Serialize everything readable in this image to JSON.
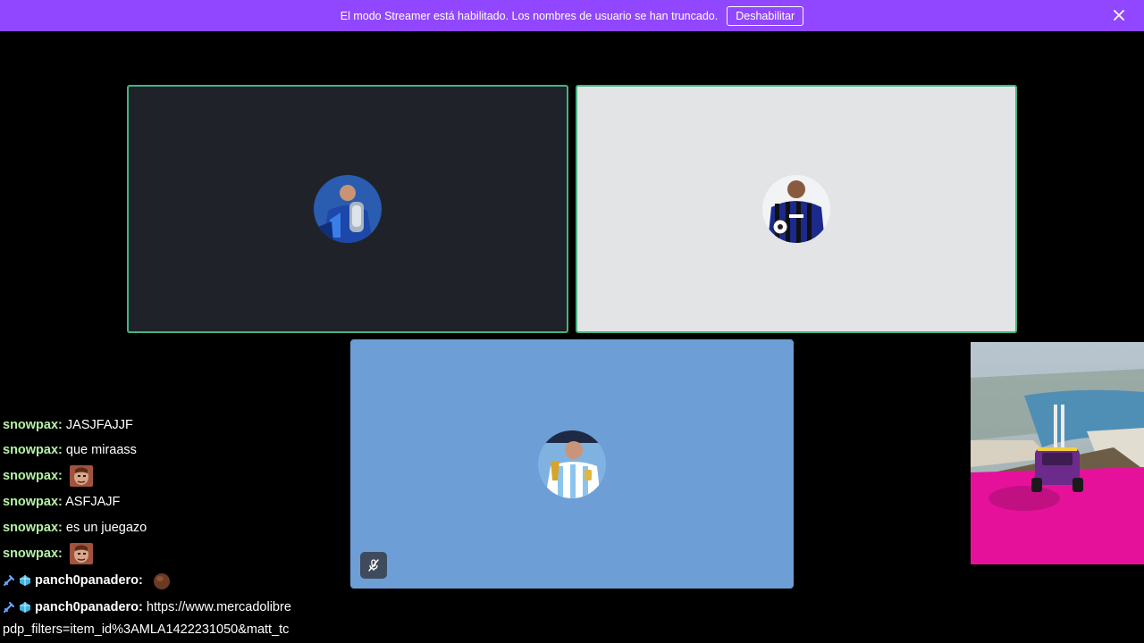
{
  "banner": {
    "message": "El modo Streamer está habilitado. Los nombres de usuario se han truncado.",
    "button_label": "Deshabilitar",
    "close_icon": "close-icon",
    "color": "#9147ff"
  },
  "tiles": [
    {
      "name": "participant-1",
      "background": "#1f2229",
      "speaking": true,
      "avatar": "avatar-blue-jersey-trophy"
    },
    {
      "name": "participant-2",
      "background": "#e3e4e6",
      "speaking": true,
      "avatar": "avatar-striped-jersey-ball"
    },
    {
      "name": "participant-3",
      "background": "#6d9fd6",
      "speaking": false,
      "muted": true,
      "avatar": "avatar-argentina-trophy",
      "mute_icon": "microphone-muted-icon"
    }
  ],
  "chat": {
    "messages": [
      {
        "user": "snowpax",
        "separator": ":",
        "text": " JASJFAJJF"
      },
      {
        "user": "snowpax",
        "separator": ":",
        "text": " que miraass"
      },
      {
        "user": "snowpax",
        "separator": ":",
        "text": "",
        "emote": "face-emote"
      },
      {
        "user": "snowpax",
        "separator": ":",
        "text": " ASFJAJF"
      },
      {
        "user": "snowpax",
        "separator": ":",
        "text": " es un juegazo"
      },
      {
        "user": "snowpax",
        "separator": ":",
        "text": "",
        "emote": "face-emote"
      },
      {
        "user": "panch0panadero",
        "separator": ":",
        "text": "",
        "emote": "bread-emote",
        "badges": [
          "sword-badge",
          "gem-badge"
        ]
      },
      {
        "user": "panch0panadero",
        "separator": ":",
        "text": " https://www.mercadolibre",
        "badges": [
          "sword-badge",
          "gem-badge"
        ]
      },
      {
        "user": "",
        "separator": "",
        "text": "pdp_filters=item_id%3AMLA1422231050&matt_tc"
      }
    ],
    "user_color_green": "#b6f2a6"
  },
  "game_overlay": {
    "track_color": "#e6119a",
    "vehicle_color": "#6c2a8a"
  }
}
